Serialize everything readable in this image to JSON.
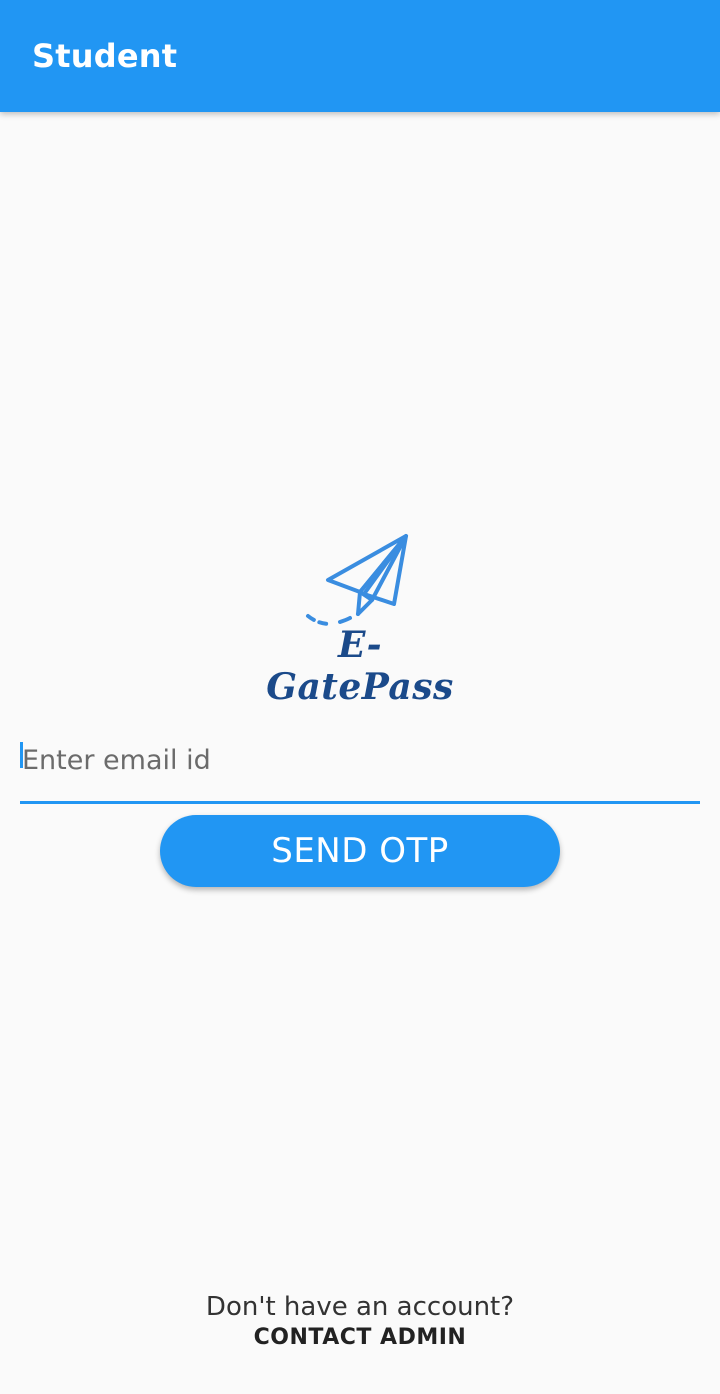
{
  "app_bar": {
    "title": "Student",
    "background_color": "#2196f3"
  },
  "logo": {
    "icon": "paper-plane-icon",
    "text": "E-GatePass",
    "icon_color": "#3a8de0",
    "text_color": "#1b4a8a"
  },
  "login_form": {
    "email_placeholder": "Enter email id",
    "email_value": "",
    "send_otp_label": "SEND OTP",
    "accent_color": "#2196f3"
  },
  "footer": {
    "prompt_text": "Don't have an account?",
    "contact_label": "CONTACT ADMIN"
  }
}
